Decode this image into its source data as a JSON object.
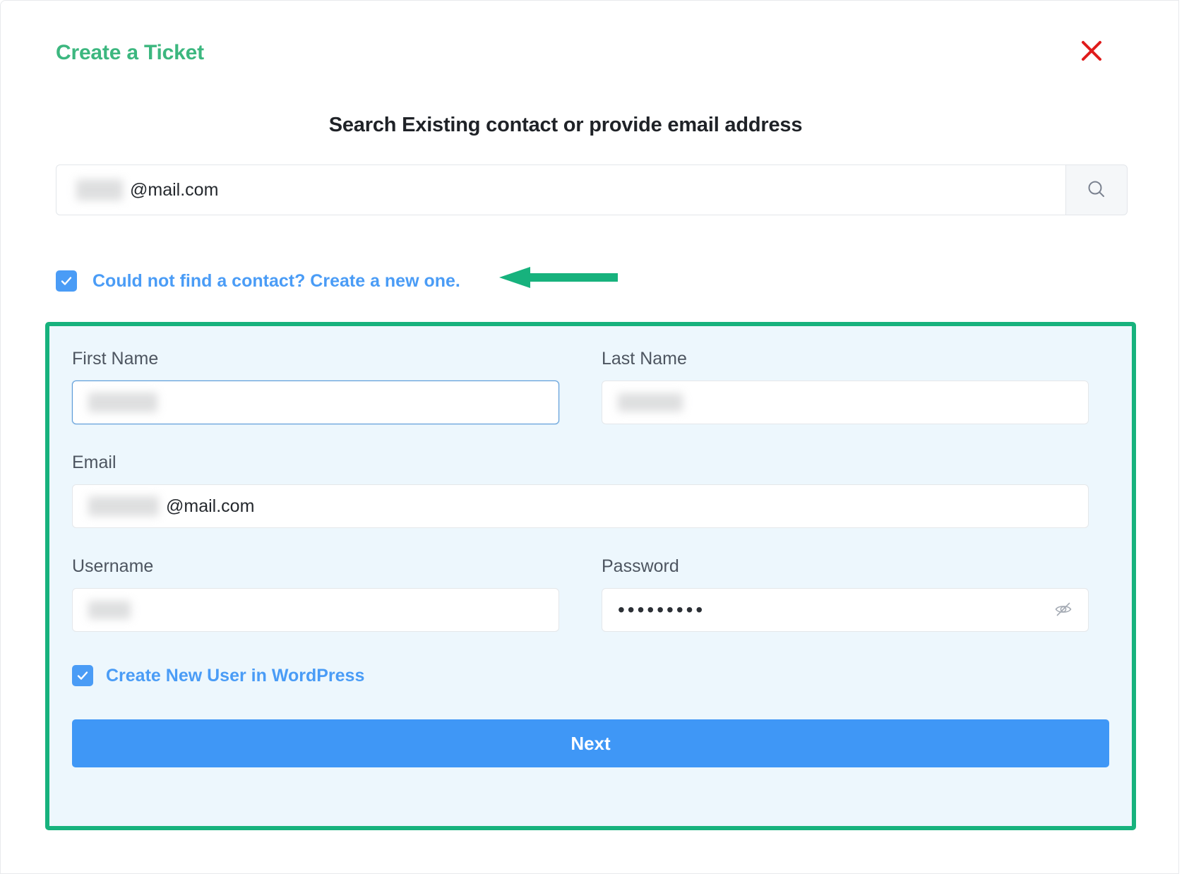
{
  "modal": {
    "title": "Create a Ticket",
    "close_icon": "close-x-icon"
  },
  "search_section": {
    "heading": "Search Existing contact or provide email address",
    "input_value_suffix": "@mail.com",
    "input_value_redacted": true,
    "search_icon": "search-magnifier-icon"
  },
  "contact_checkbox": {
    "label": "Could not find a contact? Create a new one.",
    "checked": true,
    "check_icon": "checkmark-icon"
  },
  "annotation": {
    "type": "arrow",
    "direction": "left",
    "color": "#17b27d"
  },
  "new_contact_form": {
    "border_color": "#17b27d",
    "background_color": "#edf7fd",
    "fields": [
      {
        "name": "first-name",
        "label": "First Name",
        "value_redacted": true,
        "value_suffix": "",
        "focused": true
      },
      {
        "name": "last-name",
        "label": "Last Name",
        "value_redacted": true,
        "value_suffix": "",
        "focused": false
      },
      {
        "name": "email",
        "label": "Email",
        "value_redacted": true,
        "value_suffix": "@mail.com",
        "focused": false
      },
      {
        "name": "username",
        "label": "Username",
        "value_redacted": true,
        "value_suffix": "",
        "focused": false
      },
      {
        "name": "password",
        "label": "Password",
        "value_masked": "•••••••••",
        "focused": false,
        "toggle_icon": "eye-slash-icon"
      }
    ],
    "wordpress_checkbox": {
      "label": "Create New User in WordPress",
      "checked": true,
      "check_icon": "checkmark-icon"
    },
    "next_button": {
      "label": "Next",
      "color": "#3f97f6"
    }
  },
  "colors": {
    "title_green": "#3cb77f",
    "accent_blue": "#4a9cf6",
    "panel_border_green": "#17b27d",
    "panel_bg": "#edf7fd",
    "close_red": "#e01b1b"
  }
}
